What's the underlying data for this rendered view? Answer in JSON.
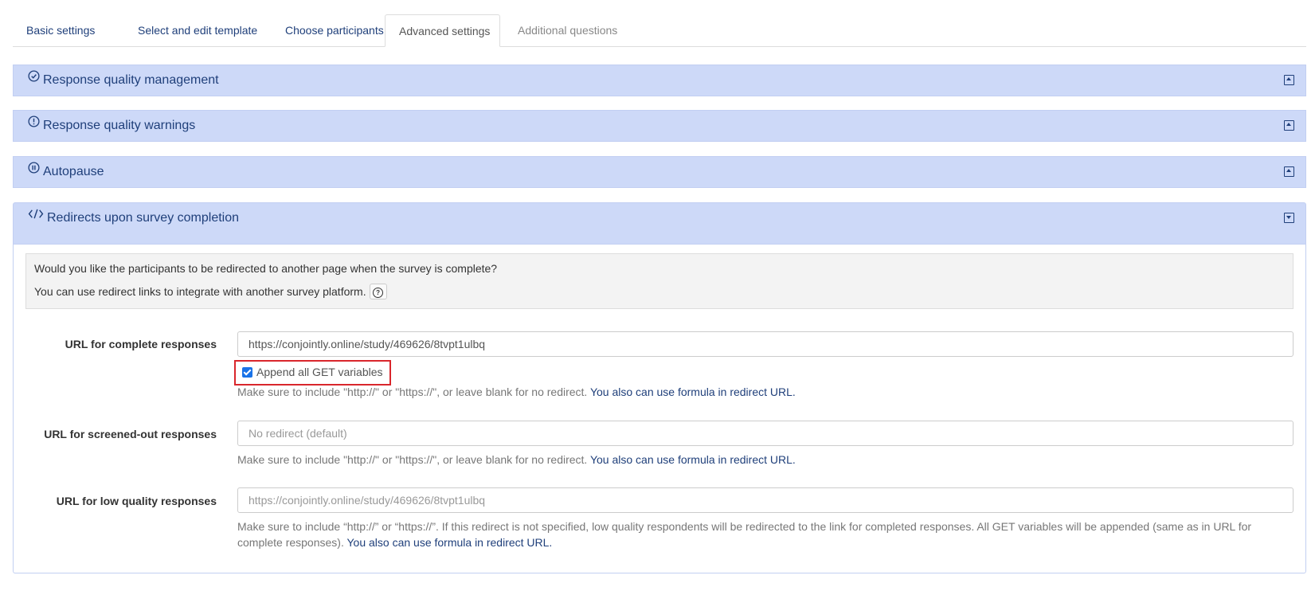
{
  "tabs": [
    {
      "label": "Basic settings"
    },
    {
      "label": "Select and edit template"
    },
    {
      "label": "Choose participants"
    },
    {
      "label": "Advanced settings"
    },
    {
      "label": "Additional questions"
    }
  ],
  "panels": {
    "quality_management": {
      "title": "Response quality management",
      "icon": "check-circle-icon",
      "state": "collapsed"
    },
    "quality_warnings": {
      "title": "Response quality warnings",
      "icon": "exclamation-circle-icon",
      "state": "collapsed"
    },
    "autopause": {
      "title": "Autopause",
      "icon": "pause-circle-icon",
      "state": "collapsed"
    },
    "redirects": {
      "title": "Redirects upon survey completion",
      "icon": "code-icon",
      "state": "expanded"
    }
  },
  "redirects": {
    "intro_line1": "Would you like the participants to be redirected to another page when the survey is complete?",
    "intro_line2": "You can use redirect links to integrate with another survey platform.",
    "complete": {
      "label": "URL for complete responses",
      "value": "https://conjointly.online/study/469626/8tvpt1ulbq",
      "checkbox_label": "Append all GET variables",
      "checkbox_checked": true,
      "hint": "Make sure to include \"http://\" or \"https://\", or leave blank for no redirect.",
      "hint_link": "You also can use formula in redirect URL."
    },
    "screened_out": {
      "label": "URL for screened-out responses",
      "placeholder": "No redirect (default)",
      "hint": "Make sure to include \"http://\" or \"https://\", or leave blank for no redirect.",
      "hint_link": "You also can use formula in redirect URL."
    },
    "low_quality": {
      "label": "URL for low quality responses",
      "placeholder": "https://conjointly.online/study/469626/8tvpt1ulbq",
      "hint": "Make sure to include “http://” or “https://”. If this redirect is not specified, low quality respondents will be redirected to the link for completed responses. All GET variables will be appended (same as in URL for complete responses).",
      "hint_link": "You also can use formula in redirect URL."
    }
  },
  "colors": {
    "accent": "#1f3f7a",
    "panel_header": "#cdd9f8",
    "highlight_border": "#d9262c",
    "checkbox": "#1a73e8"
  }
}
